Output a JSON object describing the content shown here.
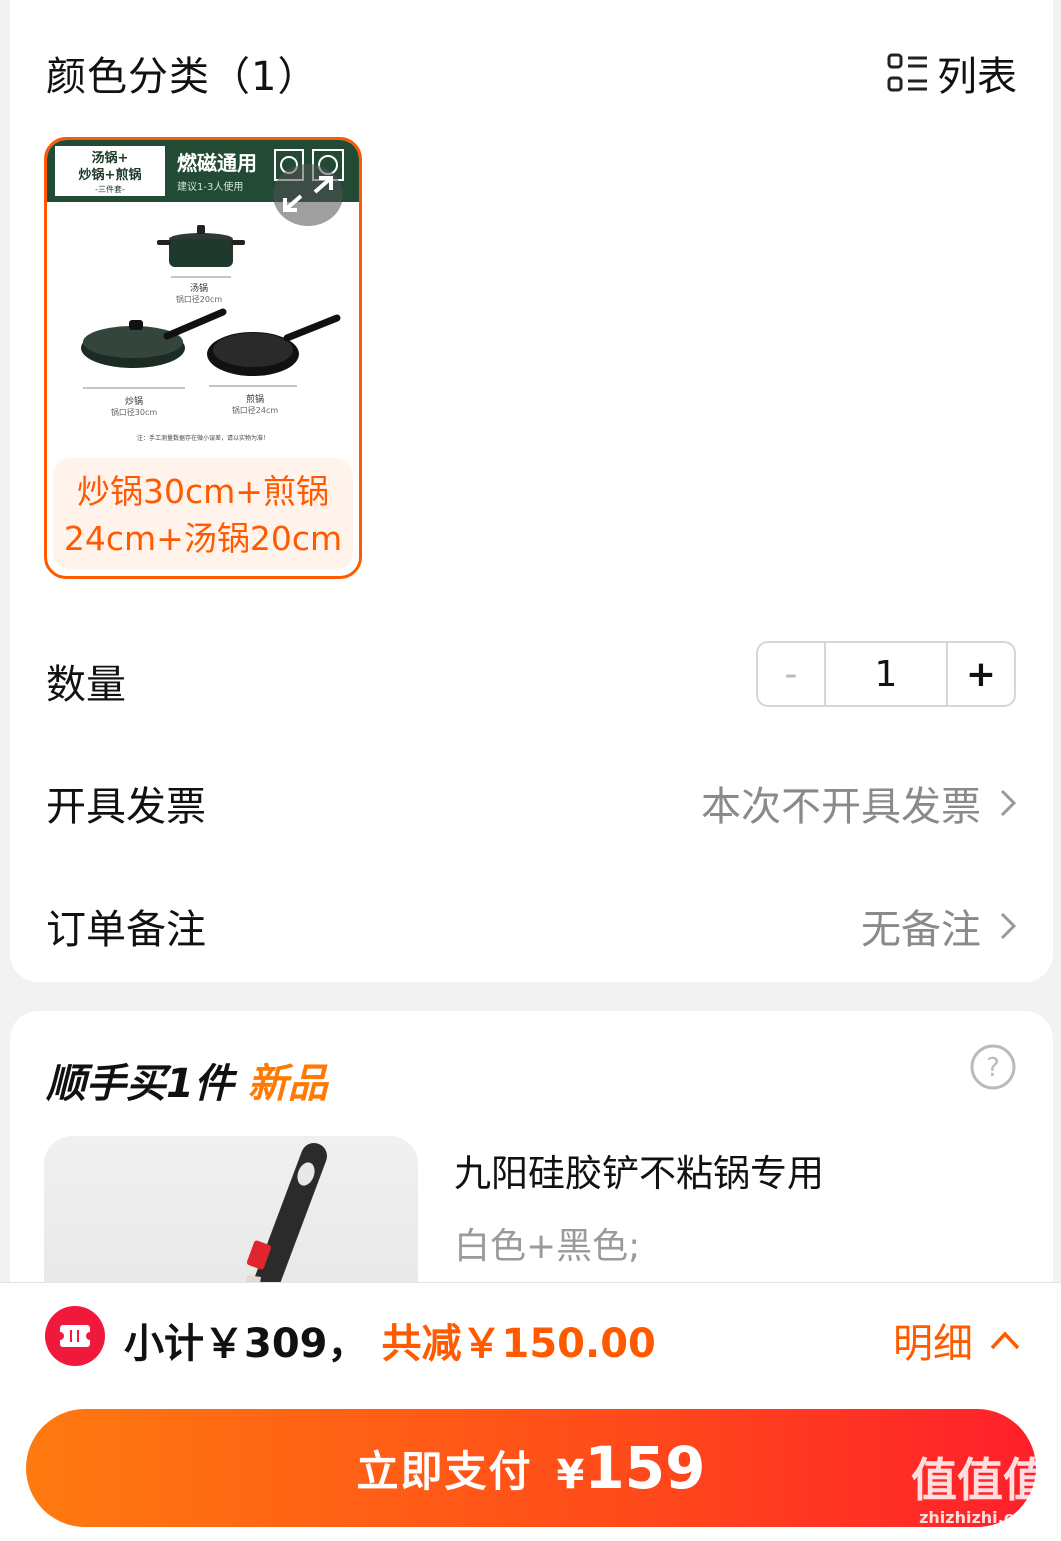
{
  "section": {
    "title": "颜色分类（1）",
    "view_label": "列表",
    "view_icon": "list-icon"
  },
  "sku": {
    "image_labels": {
      "top_left": "汤锅+炒锅+煎锅",
      "top_left_sub": "-三件套-",
      "banner": "燃磁通用",
      "banner_sub": "建议1-3人使用",
      "soup_pot": "汤锅",
      "soup_pot_size": "锅口径20cm",
      "wok": "炒锅",
      "wok_size": "锅口径30cm",
      "fry_pan": "煎锅",
      "fry_pan_size": "锅口径24cm",
      "note": "注：手工测量数据存在微小误差，请以实物为准！"
    },
    "caption": "炒锅30cm+煎锅24cm+汤锅20cm",
    "selected": true,
    "accent_color": "#ff5a00"
  },
  "quantity": {
    "label": "数量",
    "minus": "-",
    "value": "1",
    "plus": "+"
  },
  "invoice": {
    "label": "开具发票",
    "value": "本次不开具发票"
  },
  "remark": {
    "label": "订单备注",
    "value": "无备注"
  },
  "addon": {
    "title": "顺手买1件",
    "title_highlight": "新品",
    "product_name": "九阳硅胶铲不粘锅专用",
    "product_spec": "白色+黑色;"
  },
  "footer": {
    "subtotal": "小计￥309，",
    "discount": "共减￥150.00",
    "detail": "明细",
    "pay_label": "立即支付",
    "pay_currency": "¥",
    "pay_amount": "159",
    "watermark": "值值值",
    "watermark_sub": "zhizhizhi.com"
  }
}
